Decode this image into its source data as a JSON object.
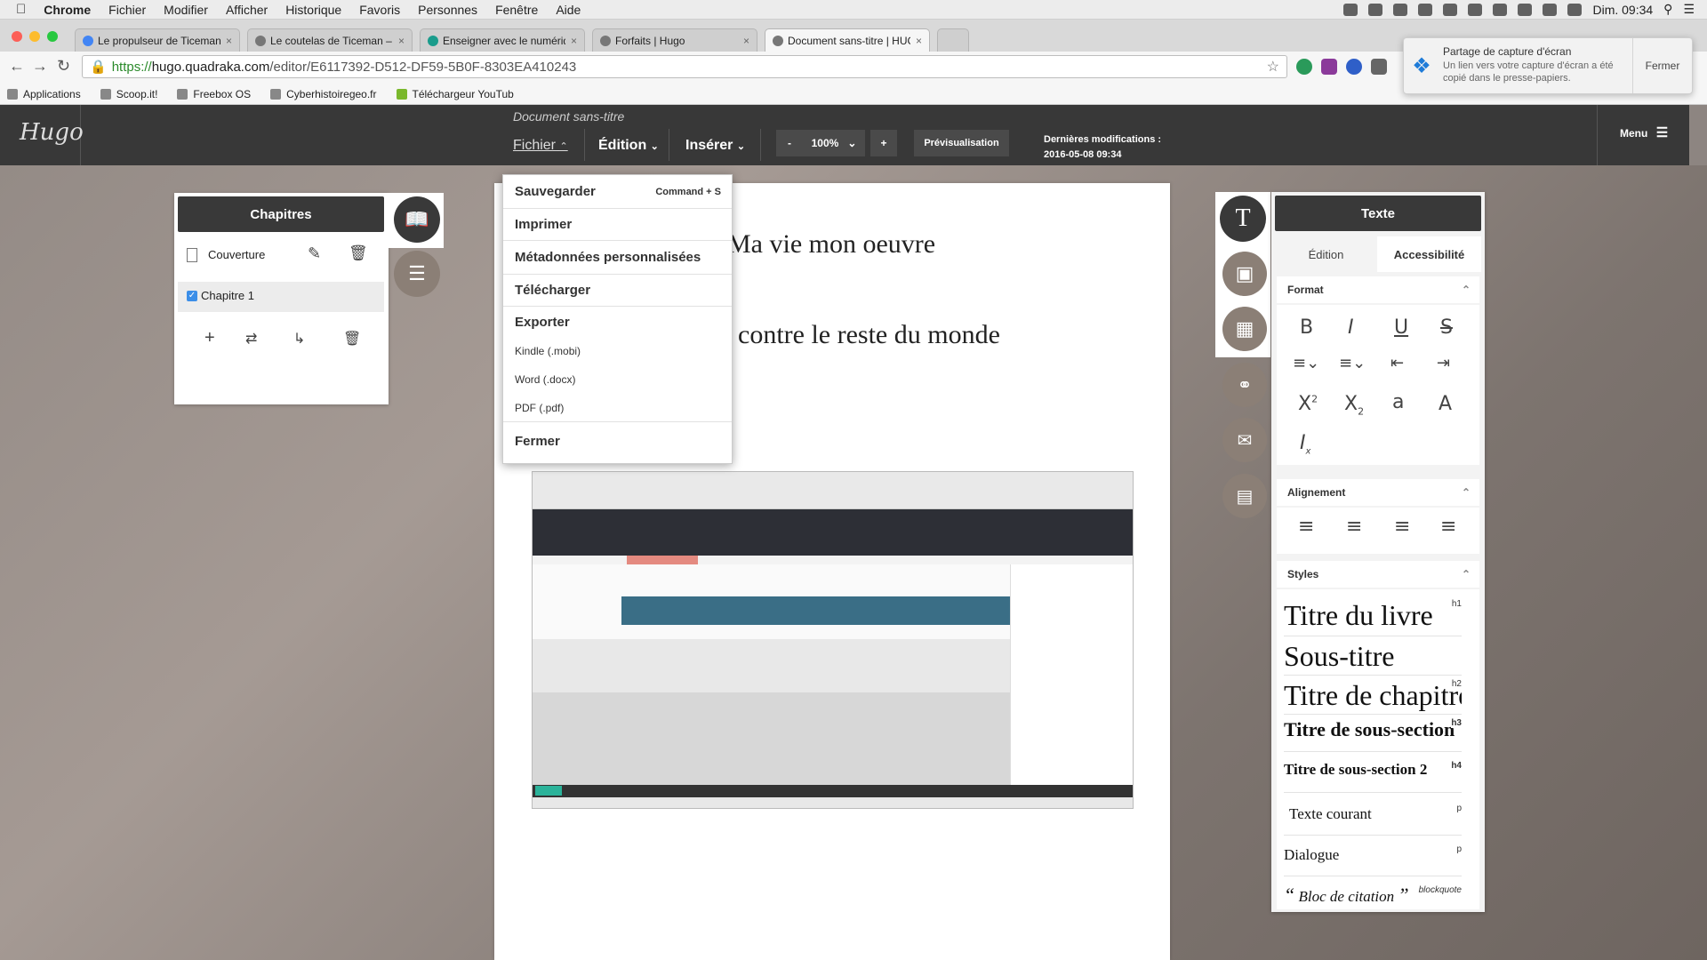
{
  "menubar": {
    "app": "Chrome",
    "items": [
      "Fichier",
      "Modifier",
      "Afficher",
      "Historique",
      "Favoris",
      "Personnes",
      "Fenêtre",
      "Aide"
    ],
    "clock": "Dim. 09:34"
  },
  "tabs": [
    {
      "label": "Le propulseur de Ticeman"
    },
    {
      "label": "Le coutelas de Ticeman – T"
    },
    {
      "label": "Enseigner avec le numériqu"
    },
    {
      "label": "Forfaits | Hugo"
    },
    {
      "label": "Document sans-titre | HUG"
    }
  ],
  "address": {
    "scheme": "https://",
    "host": "hugo.quadraka.com",
    "path": "/editor/E6117392-D512-DF59-5B0F-8303EA410243"
  },
  "bookmarks": [
    "Applications",
    "Scoop.it!",
    "Freebox OS",
    "Cyberhistoiregeo.fr",
    "Téléchargeur YouTub"
  ],
  "notification": {
    "title": "Partage de capture d'écran",
    "body": "Un lien vers votre capture d'écran a été copié dans le presse-papiers.",
    "button": "Fermer"
  },
  "hugo": {
    "logo": "Hugo",
    "doc_title": "Document sans-titre",
    "menu_fichier": "Fichier",
    "menu_edition": "Édition",
    "menu_inserer": "Insérer",
    "zoom_minus": "-",
    "zoom": "100%",
    "zoom_plus": "+",
    "preview": "Prévisualisation",
    "lastmod_label": "Dernières modifications :",
    "lastmod_value": "2016-05-08 09:34",
    "menu": "Menu"
  },
  "dropdown": {
    "save": "Sauvegarder",
    "save_shortcut": "Command + S",
    "print": "Imprimer",
    "metadata": "Métadonnées personnalisées",
    "download": "Télécharger",
    "export": "Exporter",
    "kindle": "Kindle (.mobi)",
    "word": "Word (.docx)",
    "pdf": "PDF (.pdf)",
    "close": "Fermer"
  },
  "document": {
    "line1": "Ma vie mon oeuvre",
    "line2": "contre le reste du monde"
  },
  "chapters": {
    "title": "Chapitres",
    "cover": "Couverture",
    "chapter1": "Chapitre 1"
  },
  "textpanel": {
    "title": "Texte",
    "tab_edition": "Édition",
    "tab_access": "Accessibilité",
    "format": "Format",
    "alignment": "Alignement",
    "styles": "Styles",
    "style_items": [
      {
        "label": "Titre du livre",
        "tag": "h1"
      },
      {
        "label": "Sous-titre",
        "tag": ""
      },
      {
        "label": "Titre de chapitre",
        "tag": "h2"
      },
      {
        "label": "Titre de sous-section",
        "tag": "h3"
      },
      {
        "label": "Titre de sous-section 2",
        "tag": "h4"
      },
      {
        "label": "Texte courant",
        "tag": "p"
      },
      {
        "label": "Dialogue",
        "tag": "p"
      },
      {
        "label": "Bloc de citation",
        "tag": "blockquote"
      }
    ]
  }
}
